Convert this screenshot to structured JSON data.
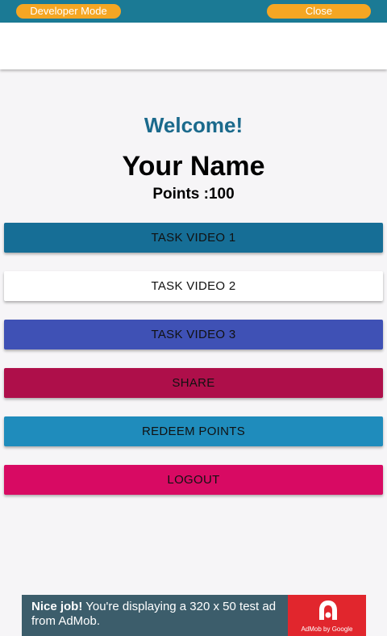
{
  "dev_bar": {
    "developer_mode_label": "Developer Mode",
    "close_label": "Close",
    "bar_color": "#1b7a95",
    "pill_color": "#f5a623"
  },
  "profile": {
    "welcome": "Welcome!",
    "name": "Your Name",
    "points": "Points :100"
  },
  "buttons": {
    "task_video_1": "TASK VIDEO 1",
    "task_video_2": "TASK VIDEO 2",
    "task_video_3": "TASK VIDEO 3",
    "share": "SHARE",
    "redeem_points": "REDEEM POINTS",
    "logout": "LOGOUT"
  },
  "ad": {
    "headline": "Nice job!",
    "body": " You're displaying a 320 x 50 test ad from AdMob.",
    "logo_text": "AdMob by Google",
    "logo_icon": "admob-logo-icon"
  }
}
